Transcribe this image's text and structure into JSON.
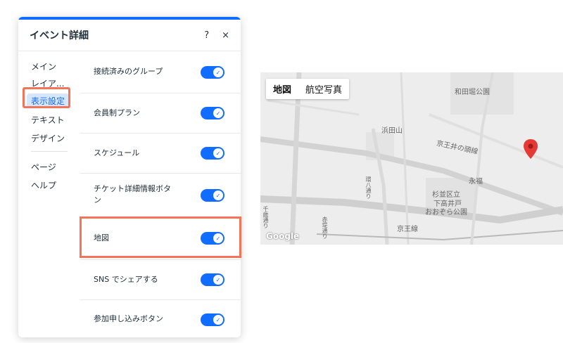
{
  "panel": {
    "title": "イベント詳細",
    "help_label": "?",
    "close_label": "×",
    "accent_color": "#116dff"
  },
  "sidenav": {
    "items": [
      {
        "label": "メイン"
      },
      {
        "label": "レイア..."
      },
      {
        "label": "表示設定",
        "active": true
      },
      {
        "label": "テキスト"
      },
      {
        "label": "デザイン"
      }
    ],
    "secondary": [
      {
        "label": "ページ"
      },
      {
        "label": "ヘルプ"
      }
    ]
  },
  "settings": [
    {
      "label": "接続済みのグループ",
      "on": true
    },
    {
      "label": "会員制プラン",
      "on": true
    },
    {
      "label": "スケジュール",
      "on": true
    },
    {
      "label": "チケット詳細情報ボタン",
      "on": true
    },
    {
      "label": "地図",
      "on": true,
      "highlighted": true
    },
    {
      "label": "SNS でシェアする",
      "on": true
    },
    {
      "label": "参加申し込みボタン",
      "on": true
    }
  ],
  "map": {
    "tabs": [
      {
        "label": "地図",
        "active": true
      },
      {
        "label": "航空写真",
        "active": false
      }
    ],
    "labels": {
      "wadabori": "和田堀公園",
      "hamadayama": "浜田山",
      "inokashira": "京王井の頭線",
      "eifuku": "永福",
      "suginami": "杉並区立",
      "shimotakaido": "下高井戸",
      "osora": "おおぞら公園",
      "keio": "京王線",
      "kanpachi": "環八通り",
      "chitose": "千歳通り",
      "akatsutsumi": "赤堤通り"
    },
    "attribution": "Google",
    "highlight_color": "#f47458",
    "pin_color": "#e53935"
  }
}
